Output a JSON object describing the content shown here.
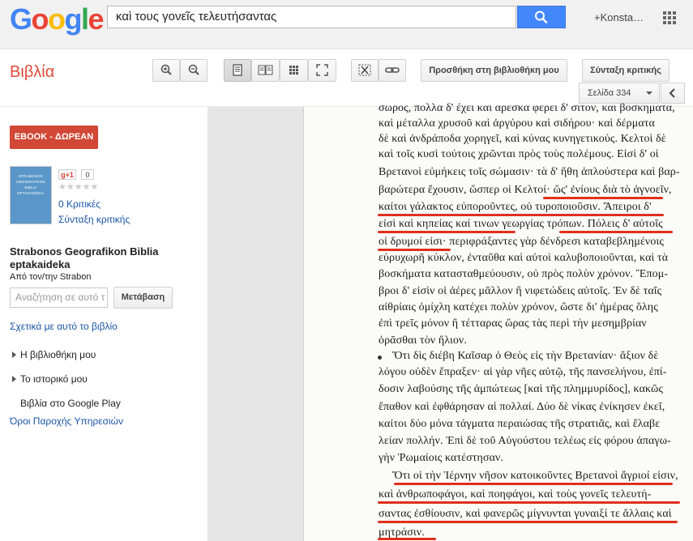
{
  "header": {
    "logo": [
      "G",
      "o",
      "o",
      "g",
      "l",
      "e"
    ],
    "logo_colors": [
      "#4285f4",
      "#ea4335",
      "#fbbc05",
      "#4285f4",
      "#34a853",
      "#ea4335"
    ],
    "search_value": "καὶ τους γονεῖς τελευτήσαντας",
    "user": "+Konsta…",
    "search_icon": "magnifier-icon",
    "apps_icon": "apps-grid-icon"
  },
  "toolbar": {
    "section": "Βιβλία",
    "add_library": "Προσθήκη στη βιβλιοθήκη μου",
    "write_review": "Σύνταξη κριτικής",
    "page_label": "Σελίδα 334",
    "icons": [
      "zoom-in-icon",
      "zoom-out-icon",
      "single-page-icon",
      "two-page-icon",
      "thumbnails-icon",
      "fullscreen-icon",
      "clip-icon",
      "link-icon",
      "chevron-left-icon"
    ]
  },
  "sidebar": {
    "ebook": "EBOOK - ΔΩΡΕΑΝ",
    "cover_text": [
      "STRABONOS",
      "GEOGRAFIKON",
      "BIBLIA",
      "EPTAKAIDEKA"
    ],
    "gplus": "g+1",
    "gplus_count": "0",
    "stars": "★★★★★",
    "reviews": "0 Κριτικές",
    "write_review": "Σύνταξη κριτικής",
    "title": "Strabonos Geografikon Biblia eptakaideka",
    "author": "Από τον/την Strabon",
    "search_placeholder": "Αναζήτηση σε αυτό τ",
    "go": "Μετάβαση",
    "related": "Σχετικά με αυτό το βιβλίο",
    "nav": [
      "Η βιβλιοθήκη μου",
      "Το ιστορικό μου",
      "Βιβλία στο Google Play"
    ],
    "terms": "Όροι Παροχής Υπηρεσιών"
  },
  "scan": {
    "lines": [
      "σωρος, πολλα δ' έχει και αρεσκα φερει δ' σιτον, και βοσκηματα,",
      "καὶ μέταλλα χρυσοῦ καὶ ἀργύρου καὶ σιδήρου· καὶ δέρματα",
      "δὲ καὶ ἀνδράποδα χορηγεῖ, καὶ κύνας κυνηγετικούς. Κελτοὶ δὲ",
      "καὶ τοῖς κυσὶ τούτοις χρῶνται πρὸς τοὺς πολέμους. Εἰσὶ δ' οἱ",
      "Βρετανοὶ εὐμήκεις τοῖς σώμασιν· τὰ δ' ἤθη ἁπλούστερα καὶ βαρ-",
      "βαρώτερα ἔχουσιν, ὥσπερ οἱ Κελτοί· ὥς' ἐνίους διὰ τὸ ἀγνοεῖν,",
      "καίτοι γάλακτος εὐποροῦντες, οὐ τυροποιοῦσιν. Ἄπειροι δ'",
      "εἰσὶ καὶ κηπείας καί τινων γεωργίας τρόπων. Πόλεις δ' αὐτοῖς",
      "οἱ δρυμοί εἰσι· περιφράξαντες γὰρ δένδρεσι καταβεβλημένοις",
      "εὐρυχωρῆ κύκλον, ἐνταῦθα καὶ αὐτοὶ καλυβοποιοῦνται, καὶ τὰ",
      "βοσκήματα κατασταθμεύουσιν, οὐ πρὸς πολὺν χρόνον. Ἔπομ-",
      "βροι δ' εἰσὶν οἱ ἀέρες μᾶλλον ἢ νιφετώδεις αὐτοῖς. Ἐν δὲ ταῖς",
      "αἰθρίαις ὀμίχλη κατέχει πολὺν χρόνον, ὥστε δι' ἡμέρας ὅλης",
      "ἐπὶ τρεῖς μόνον ἢ τέτταρας ὥρας τὰς περὶ τὴν μεσημβρίαν",
      "ὁρᾶσθαι τὸν ἥλιον.",
      "Ὅτι δὶς διέβη Καῖσαρ ὁ Θεὸς εἰς τὴν Βρετανίαν· ἄξιον δὲ",
      "λόγου οὐδὲν ἔπραξεν· αἱ γὰρ νῆες αὐτῷ, τῆς πανσελήνου, ἐπί-",
      "δοσιν λαβούσης τῆς ἀμπώτεως [καὶ τῆς πλημμυρίδος], κακῶς",
      "ἔπαθον καὶ ἐφθάρησαν αἱ πολλαί. Δύο δὲ νίκας ἐνίκησεν ἐκεῖ,",
      "καίτοι δύο μόνα τάγματα περαιώσας τῆς στρατιᾶς, καὶ ἔλαβε",
      "λείαν πολλήν. Ἐπὶ δὲ τοῦ Αὐγούστου τελέως εἰς φόρου ἀπαγω-",
      "γὴν Ῥωμαίοις κατέστησαν.",
      "Ὅτι οἱ τὴν Ἰέρνην νῆσον κατοικοῦντες Βρετανοὶ ἄγριοί εἰσιν,",
      "καὶ ἀνθρωποφάγοι, καὶ ποηφάγοι, καὶ τοὺς γονεῖς τελευτή-",
      "σαντας ἐσθίουσιν, καὶ φανερῶς μίγνυνται γυναιξί τε ἄλλαις καὶ",
      "μητράσιν."
    ]
  }
}
